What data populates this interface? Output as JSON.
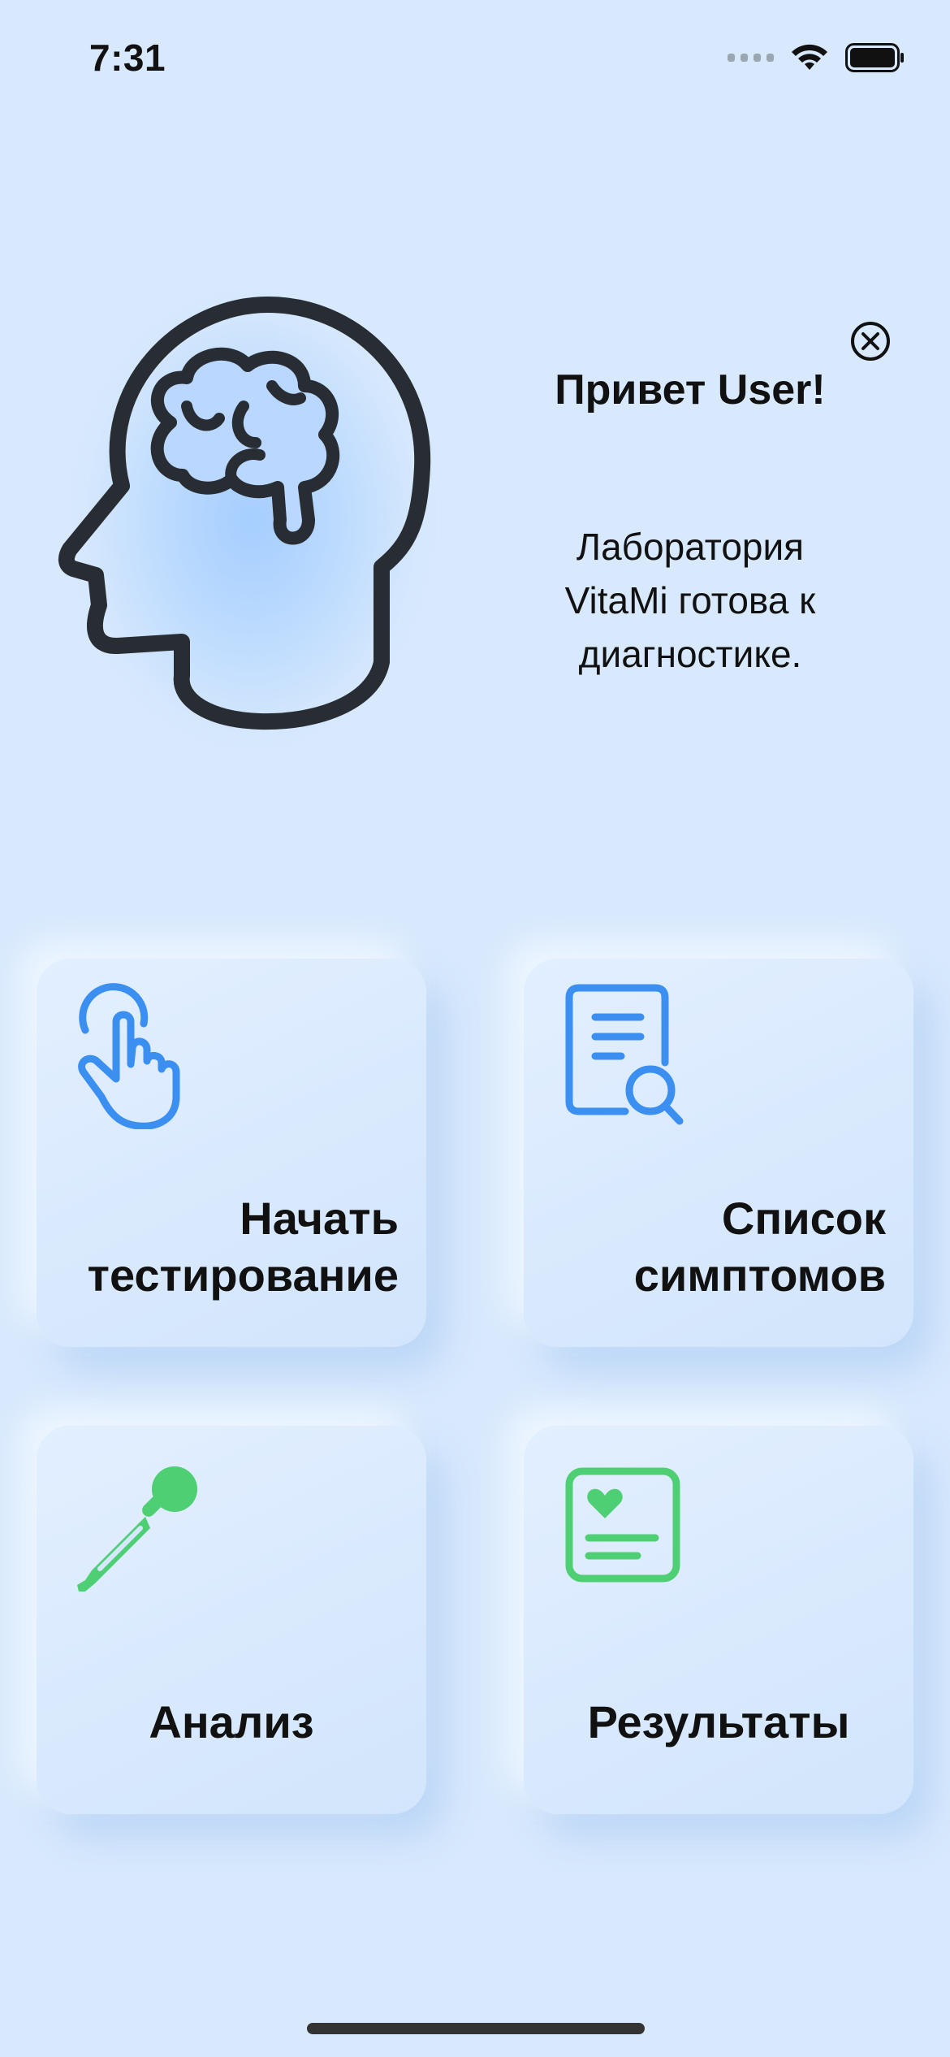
{
  "status_bar": {
    "time": "7:31"
  },
  "header": {
    "greeting": "Привет User!",
    "subtitle_line1": "Лаборатория",
    "subtitle_line2": "VitaMi готова к",
    "subtitle_line3": "диагностике."
  },
  "cards": {
    "test": {
      "line1": "Начать",
      "line2": "тестирование",
      "icon": "tap-hand-icon"
    },
    "symptoms": {
      "line1": "Список",
      "line2": "симптомов",
      "icon": "document-search-icon"
    },
    "analysis": {
      "label": "Анализ",
      "icon": "pipette-icon"
    },
    "results": {
      "label": "Результаты",
      "icon": "medical-report-icon"
    }
  },
  "colors": {
    "background": "#d8e9fd",
    "blue_accent": "#3a8ff0",
    "green_accent": "#4fcf74",
    "head_outline": "#282d33"
  }
}
